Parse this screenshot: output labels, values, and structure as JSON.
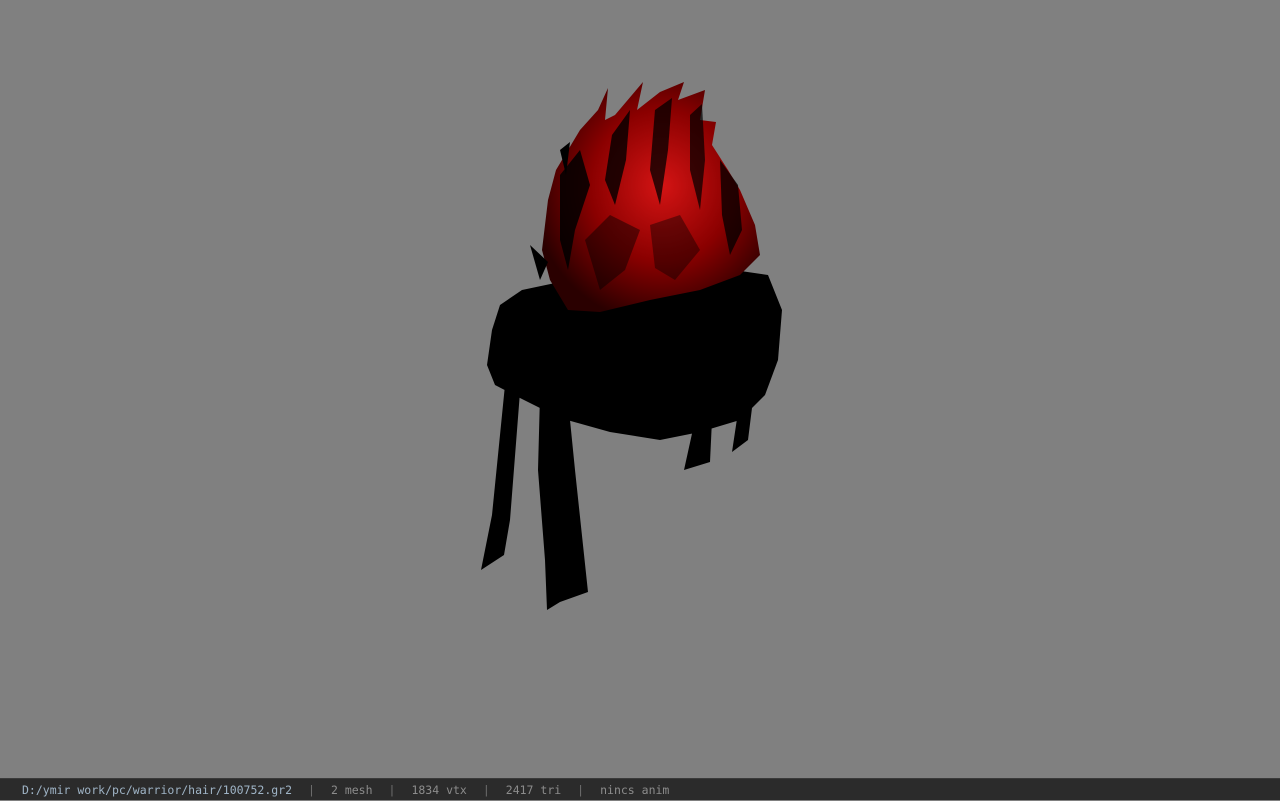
{
  "viewport": {
    "background_color": "#808080",
    "model": {
      "name": "hair-mesh",
      "colors": {
        "dark": "#000000",
        "red": "#8a0000",
        "red_highlight": "#d01010"
      }
    }
  },
  "status_bar": {
    "file_path": "D:/ymir work/pc/warrior/hair/100752.gr2",
    "separator": "|",
    "mesh": "2 mesh",
    "vertices": "1834 vtx",
    "triangles": "2417 tri",
    "animation": "nincs anim"
  }
}
